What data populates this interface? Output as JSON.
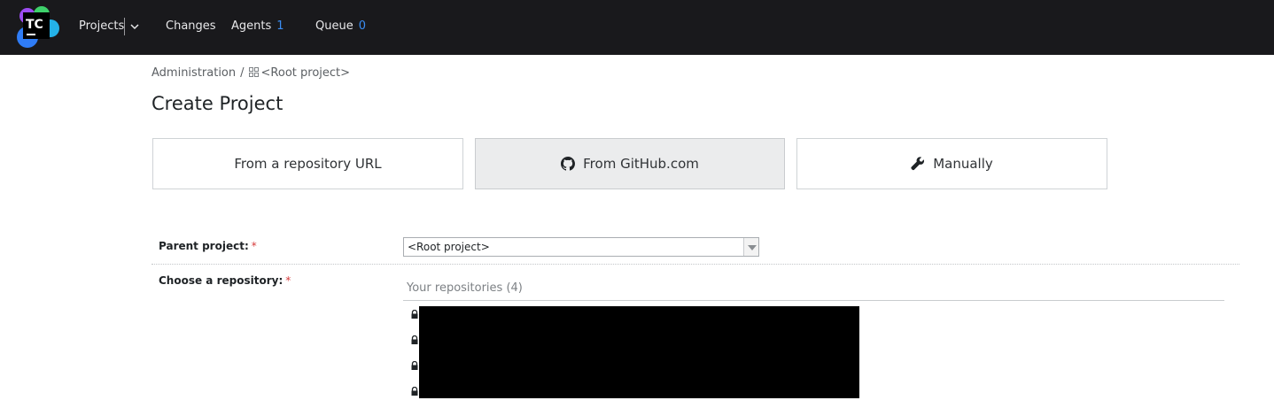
{
  "app": {
    "logo_text": "TC"
  },
  "nav": {
    "projects": "Projects",
    "changes": "Changes",
    "agents": "Agents",
    "agents_count": "1",
    "queue": "Queue",
    "queue_count": "0"
  },
  "breadcrumb": {
    "admin": "Administration",
    "separator": "/",
    "root": "<Root project>"
  },
  "page": {
    "title": "Create Project"
  },
  "options": {
    "repo_url": "From a repository URL",
    "github": "From GitHub.com",
    "manually": "Manually",
    "active": "github"
  },
  "form": {
    "parent_label": "Parent project:",
    "required_mark": "*",
    "parent_value": "<Root project>",
    "repo_label": "Choose a repository:",
    "repo_header": "Your repositories (4)"
  },
  "colors": {
    "topbar": "#19191c",
    "accent_count": "#3a8df3",
    "required": "#d63a3a"
  }
}
